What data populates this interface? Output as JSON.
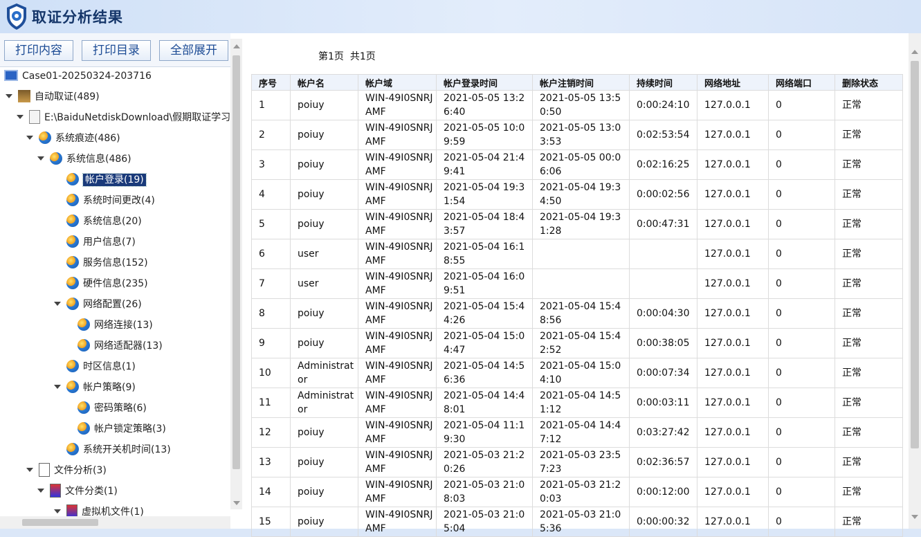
{
  "app": {
    "title": "取证分析结果"
  },
  "toolbar": {
    "print_content": "打印内容",
    "print_catalog": "打印目录",
    "expand_all": "全部展开"
  },
  "tree": [
    {
      "label": "Case01-20250324-203716",
      "icon": "computer-icon",
      "level": 0,
      "expanded": false
    },
    {
      "label": "自动取证(489)",
      "icon": "forensics-icon",
      "level": 1,
      "expanded": true
    },
    {
      "label": "E:\\BaiduNetdiskDownload\\假期取证学习",
      "icon": "document-icon",
      "level": 2,
      "expanded": true
    },
    {
      "label": "系统痕迹(486)",
      "icon": "globe-icon",
      "level": 3,
      "expanded": true
    },
    {
      "label": "系统信息(486)",
      "icon": "globe-icon",
      "level": 4,
      "expanded": true
    },
    {
      "label": "帐户登录(19)",
      "icon": "globe-icon",
      "level": 5,
      "selected": true
    },
    {
      "label": "系统时间更改(4)",
      "icon": "globe-icon",
      "level": 5
    },
    {
      "label": "系统信息(20)",
      "icon": "globe-icon",
      "level": 5
    },
    {
      "label": "用户信息(7)",
      "icon": "globe-icon",
      "level": 5
    },
    {
      "label": "服务信息(152)",
      "icon": "globe-icon",
      "level": 5
    },
    {
      "label": "硬件信息(235)",
      "icon": "globe-icon",
      "level": 5
    },
    {
      "label": "网络配置(26)",
      "icon": "globe-icon",
      "level": 5,
      "expanded": true
    },
    {
      "label": "网络连接(13)",
      "icon": "globe-icon",
      "level": 6
    },
    {
      "label": "网络适配器(13)",
      "icon": "globe-icon",
      "level": 6
    },
    {
      "label": "时区信息(1)",
      "icon": "globe-icon",
      "level": 5
    },
    {
      "label": "帐户策略(9)",
      "icon": "globe-icon",
      "level": 5,
      "expanded": true
    },
    {
      "label": "密码策略(6)",
      "icon": "globe-icon",
      "level": 6
    },
    {
      "label": "帐户锁定策略(3)",
      "icon": "globe-icon",
      "level": 6
    },
    {
      "label": "系统开关机时间(13)",
      "icon": "globe-icon",
      "level": 5
    },
    {
      "label": "文件分析(3)",
      "icon": "file-analysis-icon",
      "level": 3,
      "expanded": true
    },
    {
      "label": "文件分类(1)",
      "icon": "file-category-icon",
      "level": 4,
      "expanded": true
    },
    {
      "label": "虚拟机文件(1)",
      "icon": "file-category-icon",
      "level": 5,
      "expanded": true
    }
  ],
  "pagination": {
    "current": "第1页",
    "total": "共1页"
  },
  "table": {
    "columns": [
      "序号",
      "帐户名",
      "帐户域",
      "帐户登录时间",
      "帐户注销时间",
      "持续时间",
      "网络地址",
      "网络端口",
      "删除状态"
    ],
    "rows": [
      [
        "1",
        "poiuy",
        "WIN-49I0SNRJAMF",
        "2021-05-05 13:26:40",
        "2021-05-05 13:50:50",
        "0:00:24:10",
        "127.0.0.1",
        "0",
        "正常"
      ],
      [
        "2",
        "poiuy",
        "WIN-49I0SNRJAMF",
        "2021-05-05 10:09:59",
        "2021-05-05 13:03:53",
        "0:02:53:54",
        "127.0.0.1",
        "0",
        "正常"
      ],
      [
        "3",
        "poiuy",
        "WIN-49I0SNRJAMF",
        "2021-05-04 21:49:41",
        "2021-05-05 00:06:06",
        "0:02:16:25",
        "127.0.0.1",
        "0",
        "正常"
      ],
      [
        "4",
        "poiuy",
        "WIN-49I0SNRJAMF",
        "2021-05-04 19:31:54",
        "2021-05-04 19:34:50",
        "0:00:02:56",
        "127.0.0.1",
        "0",
        "正常"
      ],
      [
        "5",
        "poiuy",
        "WIN-49I0SNRJAMF",
        "2021-05-04 18:43:57",
        "2021-05-04 19:31:28",
        "0:00:47:31",
        "127.0.0.1",
        "0",
        "正常"
      ],
      [
        "6",
        "user",
        "WIN-49I0SNRJAMF",
        "2021-05-04 16:18:55",
        "",
        "",
        "127.0.0.1",
        "0",
        "正常"
      ],
      [
        "7",
        "user",
        "WIN-49I0SNRJAMF",
        "2021-05-04 16:09:51",
        "",
        "",
        "127.0.0.1",
        "0",
        "正常"
      ],
      [
        "8",
        "poiuy",
        "WIN-49I0SNRJAMF",
        "2021-05-04 15:44:26",
        "2021-05-04 15:48:56",
        "0:00:04:30",
        "127.0.0.1",
        "0",
        "正常"
      ],
      [
        "9",
        "poiuy",
        "WIN-49I0SNRJAMF",
        "2021-05-04 15:04:47",
        "2021-05-04 15:42:52",
        "0:00:38:05",
        "127.0.0.1",
        "0",
        "正常"
      ],
      [
        "10",
        "Administrator",
        "WIN-49I0SNRJAMF",
        "2021-05-04 14:56:36",
        "2021-05-04 15:04:10",
        "0:00:07:34",
        "127.0.0.1",
        "0",
        "正常"
      ],
      [
        "11",
        "Administrator",
        "WIN-49I0SNRJAMF",
        "2021-05-04 14:48:01",
        "2021-05-04 14:51:12",
        "0:00:03:11",
        "127.0.0.1",
        "0",
        "正常"
      ],
      [
        "12",
        "poiuy",
        "WIN-49I0SNRJAMF",
        "2021-05-04 11:19:30",
        "2021-05-04 14:47:12",
        "0:03:27:42",
        "127.0.0.1",
        "0",
        "正常"
      ],
      [
        "13",
        "poiuy",
        "WIN-49I0SNRJAMF",
        "2021-05-03 21:20:26",
        "2021-05-03 23:57:23",
        "0:02:36:57",
        "127.0.0.1",
        "0",
        "正常"
      ],
      [
        "14",
        "poiuy",
        "WIN-49I0SNRJAMF",
        "2021-05-03 21:08:03",
        "2021-05-03 21:20:03",
        "0:00:12:00",
        "127.0.0.1",
        "0",
        "正常"
      ],
      [
        "15",
        "poiuy",
        "WIN-49I0SNRJAMF",
        "2021-05-03 21:05:04",
        "2021-05-03 21:05:36",
        "0:00:00:32",
        "127.0.0.1",
        "0",
        "正常"
      ]
    ]
  }
}
